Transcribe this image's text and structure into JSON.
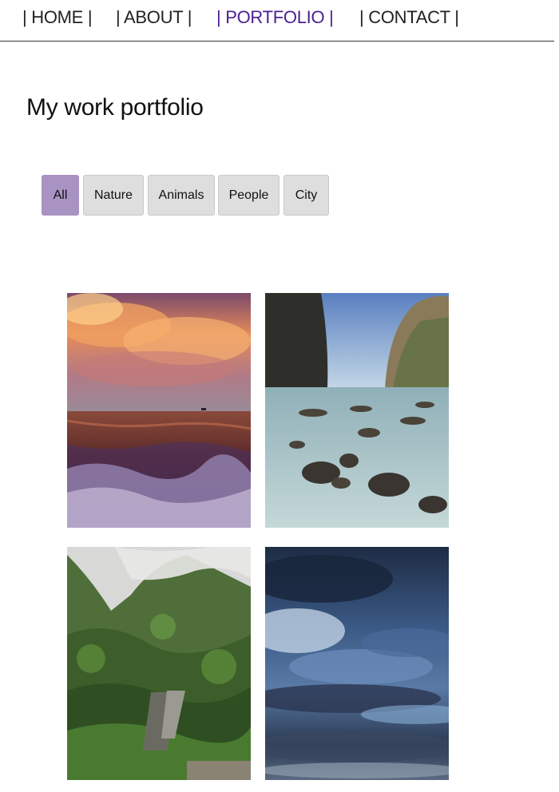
{
  "nav": {
    "items": [
      {
        "label": "| HOME |",
        "active": false
      },
      {
        "label": "| ABOUT |",
        "active": false
      },
      {
        "label": "| PORTFOLIO |",
        "active": true
      },
      {
        "label": "| CONTACT |",
        "active": false
      }
    ],
    "active_color": "#4b1f8f"
  },
  "page": {
    "title": "My work portfolio"
  },
  "filters": {
    "items": [
      {
        "label": "All",
        "active": true
      },
      {
        "label": "Nature",
        "active": false
      },
      {
        "label": "Animals",
        "active": false
      },
      {
        "label": "People",
        "active": false
      },
      {
        "label": "City",
        "active": false
      }
    ],
    "active_color": "#a893c2"
  },
  "gallery": {
    "photos": [
      {
        "subject": "sunset-sea"
      },
      {
        "subject": "rocky-beach-cliffs"
      },
      {
        "subject": "misty-green-mountains"
      },
      {
        "subject": "cloudy-sky"
      }
    ]
  }
}
